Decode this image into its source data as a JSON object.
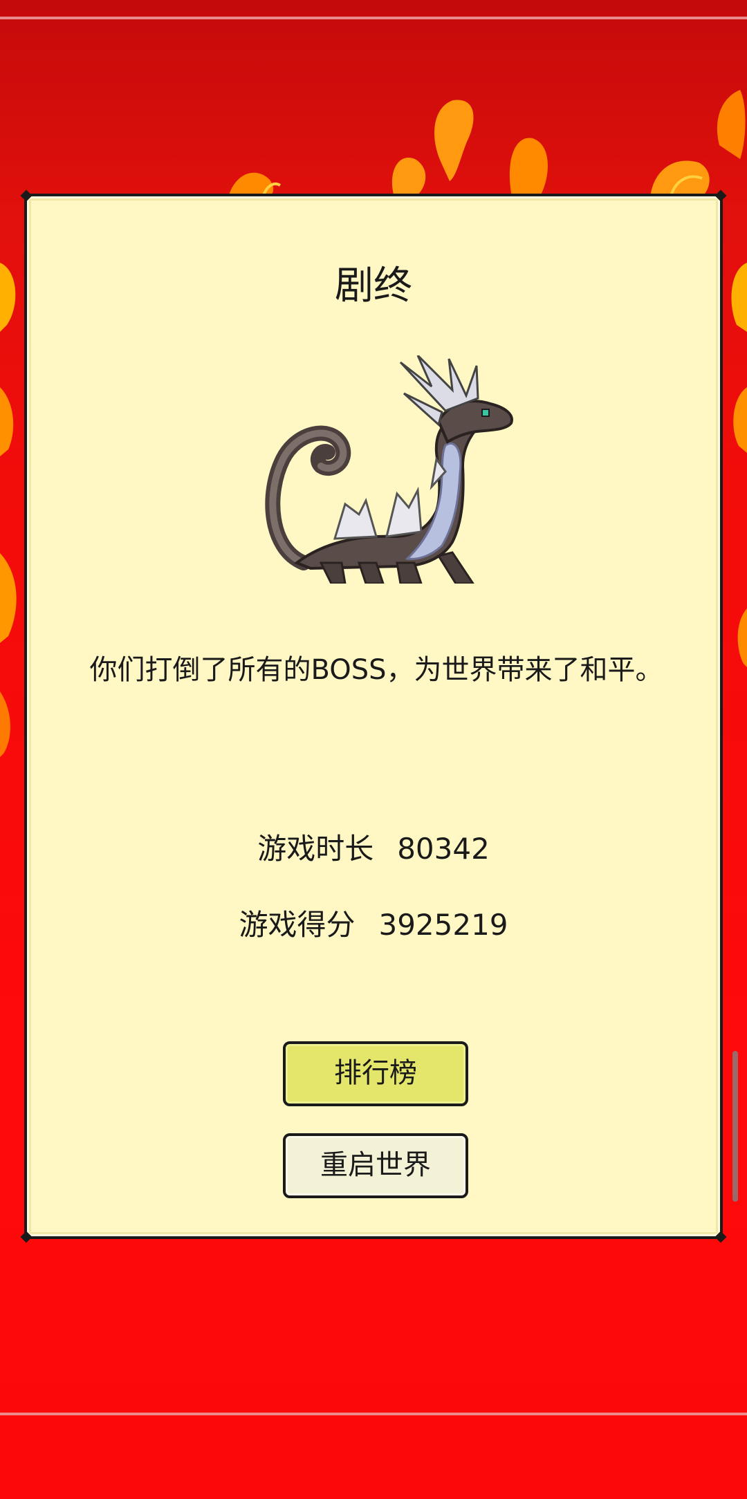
{
  "dialog": {
    "title": "剧终",
    "message": "你们打倒了所有的BOSS，为世界带来了和平。",
    "stats": {
      "time_label": "游戏时长",
      "time_value": "80342",
      "score_label": "游戏得分",
      "score_value": "3925219"
    },
    "buttons": {
      "leaderboard_label": "排行榜",
      "restart_label": "重启世界"
    }
  },
  "colors": {
    "background": "#f00a0a",
    "panel": "#fff8c4",
    "leaderboard_button": "#e3e66a",
    "restart_button": "#f3f1d6",
    "border": "#1a1a1a"
  },
  "icons": {
    "boss": "dragon-sprite"
  }
}
